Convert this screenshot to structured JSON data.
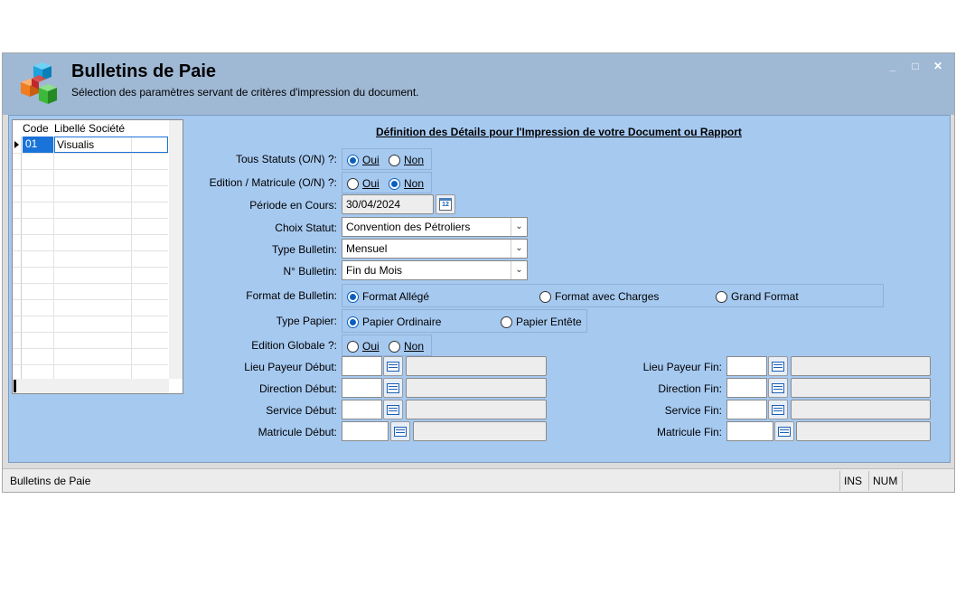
{
  "window": {
    "title": "Bulletins de Paie",
    "subtitle": "Sélection des paramètres servant de critères d'impression du document.",
    "controls": {
      "minimize": "_",
      "maximize": "□",
      "close": "✕"
    }
  },
  "grid": {
    "columns": [
      "Code",
      "Libellé Société"
    ],
    "rows": [
      {
        "code": "01",
        "label": "Visualis"
      }
    ]
  },
  "form": {
    "title": "Définition des Détails pour l'Impression de votre Document ou Rapport",
    "tous_statuts": {
      "label": "Tous Statuts (O/N) ?:",
      "oui": "Oui",
      "non": "Non",
      "selected": "Oui"
    },
    "edition_matricule": {
      "label": "Edition / Matricule (O/N) ?:",
      "oui": "Oui",
      "non": "Non",
      "selected": "Non"
    },
    "periode": {
      "label": "Période en Cours:",
      "value": "30/04/2024",
      "calendar_icon": "12"
    },
    "choix_statut": {
      "label": "Choix Statut:",
      "value": "Convention des Pétroliers"
    },
    "type_bulletin": {
      "label": "Type Bulletin:",
      "value": "Mensuel"
    },
    "numero_bulletin": {
      "label": "N° Bulletin:",
      "value": "Fin du Mois"
    },
    "format_bulletin": {
      "label": "Format de Bulletin:",
      "options": [
        "Format Allégé",
        "Format  avec Charges",
        "Grand Format"
      ],
      "selected": "Format Allégé"
    },
    "type_papier": {
      "label": "Type Papier:",
      "options": [
        "Papier Ordinaire",
        "Papier Entête"
      ],
      "selected": "Papier Ordinaire"
    },
    "edition_globale": {
      "label": "Edition Globale ?:",
      "oui": "Oui",
      "non": "Non",
      "selected": "Oui"
    },
    "lieu_payeur_debut": {
      "label": "Lieu Payeur Début:",
      "code": "",
      "desc": ""
    },
    "direction_debut": {
      "label": "Direction Début:",
      "code": "",
      "desc": ""
    },
    "service_debut": {
      "label": "Service Début:",
      "code": "",
      "desc": ""
    },
    "matricule_debut": {
      "label": "Matricule Début:",
      "code": "",
      "desc": ""
    },
    "lieu_payeur_fin": {
      "label": "Lieu Payeur Fin:",
      "code": "",
      "desc": ""
    },
    "direction_fin": {
      "label": "Direction Fin:",
      "code": "",
      "desc": ""
    },
    "service_fin": {
      "label": "Service Fin:",
      "code": "",
      "desc": ""
    },
    "matricule_fin": {
      "label": "Matricule Fin:",
      "code": "",
      "desc": ""
    }
  },
  "statusbar": {
    "text": "Bulletins de Paie",
    "ins": "INS",
    "num": "NUM"
  },
  "colors": {
    "header_bg": "#9fb8d4",
    "panel_bg": "#a6c9f0",
    "radio_accent": "#0a5fbf",
    "grid_selected": "#1a73d9"
  }
}
